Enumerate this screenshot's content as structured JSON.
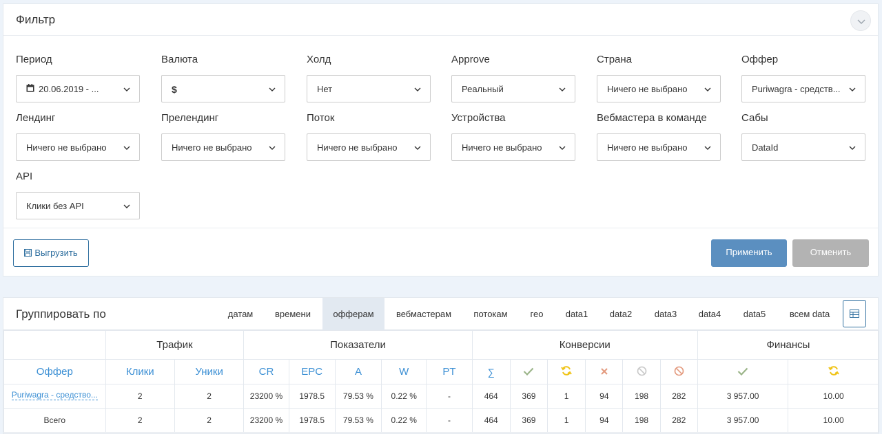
{
  "filter": {
    "title": "Фильтр",
    "fields": [
      {
        "label": "Период",
        "value": "20.06.2019 - ..."
      },
      {
        "label": "Валюта",
        "value": "$"
      },
      {
        "label": "Холд",
        "value": "Нет"
      },
      {
        "label": "Approve",
        "value": "Реальный"
      },
      {
        "label": "Страна",
        "value": "Ничего не выбрано"
      },
      {
        "label": "Оффер",
        "value": "Puriwagra - средств..."
      },
      {
        "label": "Лендинг",
        "value": "Ничего не выбрано"
      },
      {
        "label": "Прелендинг",
        "value": "Ничего не выбрано"
      },
      {
        "label": "Поток",
        "value": "Ничего не выбрано"
      },
      {
        "label": "Устройства",
        "value": "Ничего не выбрано"
      },
      {
        "label": "Вебмастера в команде",
        "value": "Ничего не выбрано"
      },
      {
        "label": "Сабы",
        "value": "DataId"
      },
      {
        "label": "API",
        "value": "Клики без API"
      }
    ],
    "export_label": "Выгрузить",
    "apply_label": "Применить",
    "cancel_label": "Отменить"
  },
  "grouping": {
    "title": "Группировать по",
    "tabs": [
      "датам",
      "времени",
      "офферам",
      "вебмастерам",
      "потокам",
      "гео",
      "data1",
      "data2",
      "data3",
      "data4",
      "data5",
      "всем data"
    ],
    "active_tab": "офферам"
  },
  "table": {
    "groups": [
      "Трафик",
      "Показатели",
      "Конверсии",
      "Финансы"
    ],
    "columns": [
      "Оффер",
      "Клики",
      "Уники",
      "CR",
      "EPC",
      "A",
      "W",
      "PT",
      "∑"
    ],
    "rows": [
      {
        "offer": "Puriwagra - средство...",
        "clicks": "2",
        "uniques": "2",
        "cr": "23200 %",
        "epc": "1978.5",
        "a": "79.53 %",
        "w": "0.22 %",
        "pt": "-",
        "sum": "464",
        "approved": "369",
        "hold": "1",
        "rejected": "94",
        "trash": "198",
        "cancelled": "282",
        "fin_approved": "3 957.00",
        "fin_hold": "10.00"
      },
      {
        "offer": "Всего",
        "clicks": "2",
        "uniques": "2",
        "cr": "23200 %",
        "epc": "1978.5",
        "a": "79.53 %",
        "w": "0.22 %",
        "pt": "-",
        "sum": "464",
        "approved": "369",
        "hold": "1",
        "rejected": "94",
        "trash": "198",
        "cancelled": "282",
        "fin_approved": "3 957.00",
        "fin_hold": "10.00"
      }
    ]
  },
  "colors": {
    "accent": "#3b8fd4",
    "apply": "#5b8fc0",
    "cancel": "#b3b3b3",
    "check": "#9cb58a",
    "refresh": "#f0c419",
    "cross": "#e39a7e",
    "ban": "#c8c8c8",
    "ban_red": "#e39a7e"
  }
}
